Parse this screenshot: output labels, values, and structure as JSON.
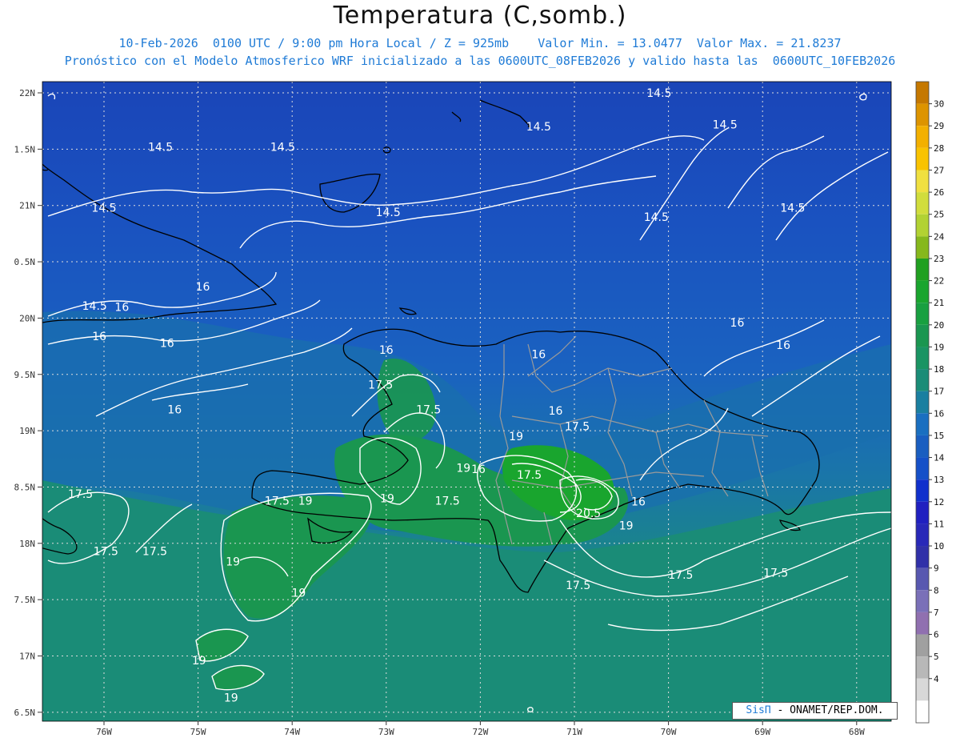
{
  "title": "Temperatura (C,somb.)",
  "subtitle_line1": "10-Feb-2026  0100 UTC / 9:00 pm Hora Local / Z = 925mb    Valor Min. = 13.0477  Valor Max. = 21.8237",
  "subtitle_line2": "Pronóstico con el Modelo Atmosferico WRF inicializado a las 0600UTC_08FEB2026 y valido hasta las  0600UTC_10FEB2026",
  "map": {
    "lon_labels": [
      "76W",
      "75W",
      "74W",
      "73W",
      "72W",
      "71W",
      "70W",
      "69W",
      "68W"
    ],
    "lat_labels": [
      "22N",
      "1.5N",
      "21N",
      "0.5N",
      "20N",
      "9.5N",
      "19N",
      "8.5N",
      "18N",
      "7.5N",
      "17N",
      "6.5N"
    ],
    "contour_labels": [
      {
        "text": "14.5",
        "lon": -75.4,
        "lat": 21.52
      },
      {
        "text": "14.5",
        "lon": -76.0,
        "lat": 20.98
      },
      {
        "text": "14.5",
        "lon": -74.1,
        "lat": 21.52
      },
      {
        "text": "14.5",
        "lon": -72.98,
        "lat": 20.94
      },
      {
        "text": "14.5",
        "lon": -71.38,
        "lat": 21.7
      },
      {
        "text": "14.5",
        "lon": -70.1,
        "lat": 22.0
      },
      {
        "text": "14.5",
        "lon": -70.13,
        "lat": 20.9
      },
      {
        "text": "14.5",
        "lon": -69.4,
        "lat": 21.72
      },
      {
        "text": "14.5",
        "lon": -68.68,
        "lat": 20.98
      },
      {
        "text": "14.5",
        "lon": -76.1,
        "lat": 20.11
      },
      {
        "text": "16",
        "lon": -75.81,
        "lat": 20.1
      },
      {
        "text": "16",
        "lon": -74.95,
        "lat": 20.28
      },
      {
        "text": "16",
        "lon": -76.05,
        "lat": 19.84
      },
      {
        "text": "16",
        "lon": -75.33,
        "lat": 19.78
      },
      {
        "text": "16",
        "lon": -75.25,
        "lat": 19.19
      },
      {
        "text": "16",
        "lon": -73.0,
        "lat": 19.72
      },
      {
        "text": "16",
        "lon": -71.38,
        "lat": 19.68
      },
      {
        "text": "16",
        "lon": -69.27,
        "lat": 19.96
      },
      {
        "text": "16",
        "lon": -68.78,
        "lat": 19.76
      },
      {
        "text": "16",
        "lon": -71.2,
        "lat": 19.18
      },
      {
        "text": "16",
        "lon": -72.02,
        "lat": 18.66
      },
      {
        "text": "16",
        "lon": -70.32,
        "lat": 18.37
      },
      {
        "text": "17.5",
        "lon": -73.06,
        "lat": 19.41
      },
      {
        "text": "17.5",
        "lon": -72.55,
        "lat": 19.19
      },
      {
        "text": "17.5",
        "lon": -70.97,
        "lat": 19.04
      },
      {
        "text": "17.5",
        "lon": -71.48,
        "lat": 18.61
      },
      {
        "text": "17.5",
        "lon": -72.35,
        "lat": 18.38
      },
      {
        "text": "17.5",
        "lon": -74.16,
        "lat": 18.38
      },
      {
        "text": "17.5",
        "lon": -76.25,
        "lat": 18.44
      },
      {
        "text": "17.5",
        "lon": -75.98,
        "lat": 17.93
      },
      {
        "text": "17.5",
        "lon": -75.46,
        "lat": 17.93
      },
      {
        "text": "17.5",
        "lon": -70.96,
        "lat": 17.63
      },
      {
        "text": "17.5",
        "lon": -69.87,
        "lat": 17.72
      },
      {
        "text": "17.5",
        "lon": -68.86,
        "lat": 17.74
      },
      {
        "text": "19",
        "lon": -73.86,
        "lat": 18.38
      },
      {
        "text": "19",
        "lon": -72.99,
        "lat": 18.4
      },
      {
        "text": "19",
        "lon": -72.18,
        "lat": 18.67
      },
      {
        "text": "19",
        "lon": -74.63,
        "lat": 17.84
      },
      {
        "text": "19",
        "lon": -73.93,
        "lat": 17.56
      },
      {
        "text": "19",
        "lon": -74.99,
        "lat": 16.96
      },
      {
        "text": "19",
        "lon": -74.65,
        "lat": 16.63
      },
      {
        "text": "19",
        "lon": -71.62,
        "lat": 18.95
      },
      {
        "text": "19",
        "lon": -70.45,
        "lat": 18.16
      },
      {
        "text": "20.5",
        "lon": -70.85,
        "lat": 18.27
      }
    ]
  },
  "colorbar": {
    "labels": [
      "30",
      "29",
      "28",
      "27",
      "26",
      "25",
      "24",
      "23",
      "22",
      "21",
      "20",
      "19",
      "18",
      "17",
      "16",
      "15",
      "14",
      "13",
      "12",
      "11",
      "10",
      "9",
      "8",
      "7",
      "6",
      "5",
      "4"
    ],
    "colors": [
      "#c57800",
      "#dd9400",
      "#f3b000",
      "#f9c300",
      "#f0e040",
      "#d1dd3c",
      "#b2d233",
      "#86b81c",
      "#20a020",
      "#19a52e",
      "#18a040",
      "#1a9650",
      "#1a9463",
      "#1a8c77",
      "#1a7fa0",
      "#1a6fc0",
      "#1a5ec0",
      "#1550c8",
      "#1030cc",
      "#2020c0",
      "#2828b8",
      "#3030a8",
      "#5858b0",
      "#7a70b8",
      "#9070b0",
      "#a0a0a0",
      "#b8b8b8",
      "#d8d8d8",
      "#ffffff"
    ]
  },
  "credit": {
    "brand": "SisΠ",
    "rest": "- ONAMET/REP.DOM."
  }
}
